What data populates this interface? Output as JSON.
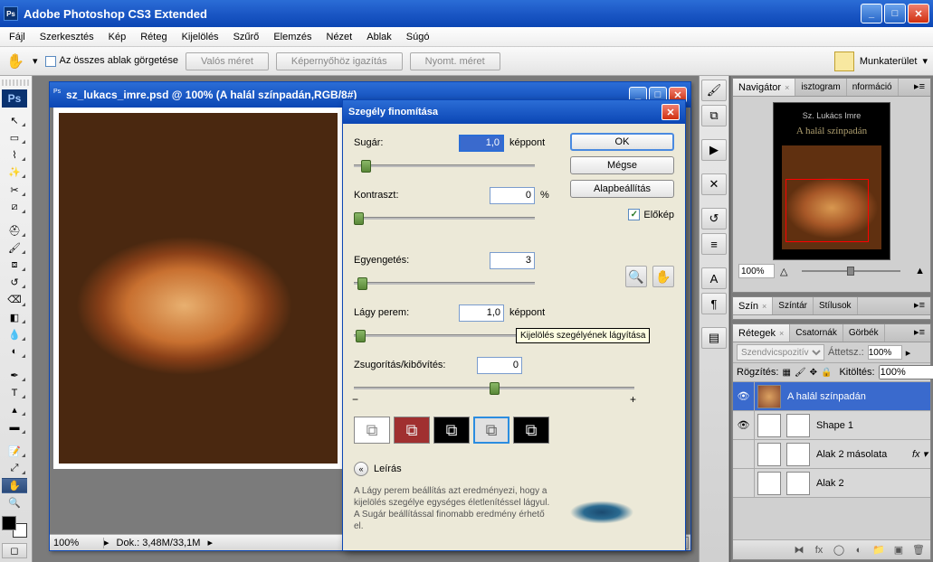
{
  "app": {
    "title": "Adobe Photoshop CS3 Extended"
  },
  "menu": [
    "Fájl",
    "Szerkesztés",
    "Kép",
    "Réteg",
    "Kijelölés",
    "Szűrő",
    "Elemzés",
    "Nézet",
    "Ablak",
    "Súgó"
  ],
  "options": {
    "scroll_all": "Az összes ablak görgetése",
    "actual": "Valós méret",
    "fit": "Képernyőhöz igazítás",
    "print": "Nyomt. méret",
    "workspace": "Munkaterület"
  },
  "docwin": {
    "title": "sz_lukacs_imre.psd @ 100% (A halál színpadán,RGB/8#)",
    "zoom": "100%",
    "docinfo": "Dok.: 3,48M/33,1M"
  },
  "dialog": {
    "title": "Szegély finomítása",
    "radius_lbl": "Sugár:",
    "radius_val": "1,0",
    "radius_unit": "képpont",
    "contrast_lbl": "Kontraszt:",
    "contrast_val": "0",
    "contrast_unit": "%",
    "smooth_lbl": "Egyengetés:",
    "smooth_val": "3",
    "feather_lbl": "Lágy perem:",
    "feather_val": "1,0",
    "feather_unit": "képpont",
    "expand_lbl": "Zsugorítás/kibővítés:",
    "expand_val": "0",
    "ok": "OK",
    "cancel": "Mégse",
    "default": "Alapbeállítás",
    "preview": "Előkép",
    "descr_lbl": "Leírás",
    "desc_text": "A Lágy perem beállítás azt eredményezi, hogy a kijelölés szegélye egységes életlenítéssel lágyul. A Sugár beállítással finomabb eredmény érhető el.",
    "tooltip": "Kijelölés szegélyének lágyítása"
  },
  "navigator": {
    "tabs": [
      "Navigátor",
      "isztogram",
      "nformáció"
    ],
    "author": "Sz. Lukács Imre",
    "book_title": "A halál színpadán",
    "zoom": "100%"
  },
  "color_tabs": [
    "Szín",
    "Színtár",
    "Stílusok"
  ],
  "layers": {
    "tabs": [
      "Rétegek",
      "Csatornák",
      "Görbék"
    ],
    "blend": "Szendvicspozitív",
    "opacity_lbl": "Áttetsz.:",
    "opacity": "100%",
    "lock_lbl": "Rögzítés:",
    "fill_lbl": "Kitöltés:",
    "fill": "100%",
    "items": [
      {
        "name": "A halál színpadán"
      },
      {
        "name": "Shape 1"
      },
      {
        "name": "Alak 2 másolata"
      },
      {
        "name": "Alak 2"
      }
    ]
  }
}
